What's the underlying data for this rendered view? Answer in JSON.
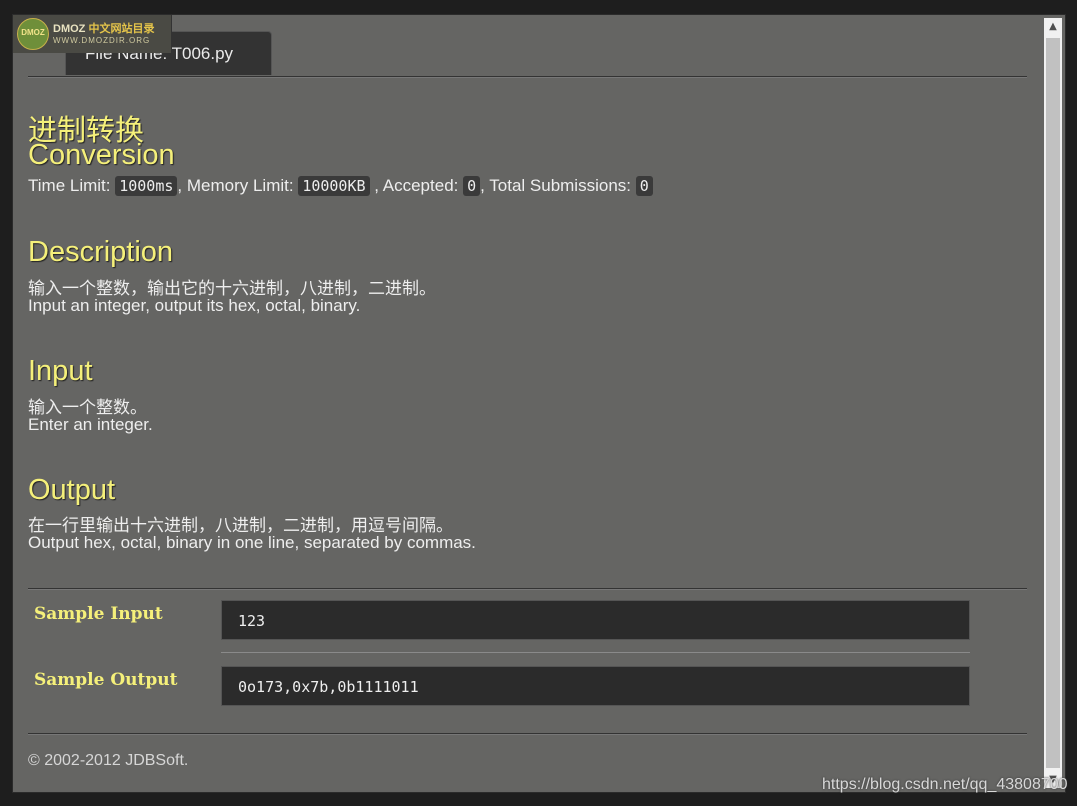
{
  "logo": {
    "globe_text": "DMOZ",
    "brand": "DMOZ",
    "brand_cn": "中文网站目录",
    "url": "WWW.DMOZDIR.ORG"
  },
  "tab": {
    "label": "File Name:  T006.py"
  },
  "problem": {
    "title_cn": "进制转换",
    "title_en": "Conversion",
    "time_limit_label": "Time Limit: ",
    "time_limit": "1000ms",
    "memory_limit_label": ", Memory Limit: ",
    "memory_limit": "10000KB",
    "accepted_label": " , Accepted: ",
    "accepted": "0",
    "total_label": ", Total Submissions: ",
    "total": "0"
  },
  "description": {
    "heading": "Description",
    "line_cn": "输入一个整数，输出它的十六进制，八进制，二进制。",
    "line_en": "Input an integer, output its hex, octal, binary."
  },
  "input": {
    "heading": "Input",
    "line_cn": "输入一个整数。",
    "line_en": "Enter an integer."
  },
  "output": {
    "heading": "Output",
    "line_cn": "在一行里输出十六进制，八进制，二进制，用逗号间隔。",
    "line_en": "Output hex, octal, binary in one line, separated by commas."
  },
  "samples": {
    "input_label": "Sample Input",
    "input_value": "123",
    "output_label": "Sample Output",
    "output_value": "0o173,0x7b,0b1111011"
  },
  "footer": {
    "copyright": "© 2002-2012  JDBSoft."
  },
  "watermark": "https://blog.csdn.net/qq_43808700",
  "colors": {
    "heading": "#f5f07a",
    "panel_bg": "#656563",
    "code_bg": "#2b2b2b"
  }
}
